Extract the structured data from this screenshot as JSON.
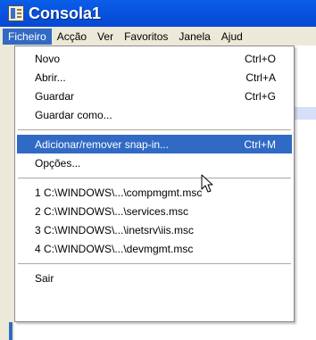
{
  "window": {
    "title": "Consola1",
    "icon": "mmc-console-icon"
  },
  "menubar": {
    "items": [
      {
        "label": "Ficheiro",
        "active": true
      },
      {
        "label": "Acção"
      },
      {
        "label": "Ver"
      },
      {
        "label": "Favoritos"
      },
      {
        "label": "Janela"
      },
      {
        "label": "Ajud"
      }
    ]
  },
  "file_menu": {
    "items": [
      {
        "label": "Novo",
        "shortcut": "Ctrl+O"
      },
      {
        "label": "Abrir...",
        "shortcut": "Ctrl+A"
      },
      {
        "label": "Guardar",
        "shortcut": "Ctrl+G"
      },
      {
        "label": "Guardar  como...",
        "shortcut": ""
      },
      {
        "label": "Adicionar/remover snap-in...",
        "shortcut": "Ctrl+M",
        "highlighted": true
      },
      {
        "label": "Opções...",
        "shortcut": ""
      },
      {
        "label": "1 C:\\WINDOWS\\...\\compmgmt.msc",
        "shortcut": ""
      },
      {
        "label": "2 C:\\WINDOWS\\...\\services.msc",
        "shortcut": ""
      },
      {
        "label": "3 C:\\WINDOWS\\...\\inetsrv\\iis.msc",
        "shortcut": ""
      },
      {
        "label": "4 C:\\WINDOWS\\...\\devmgmt.msc",
        "shortcut": ""
      },
      {
        "label": "Sair",
        "shortcut": ""
      }
    ]
  },
  "colors": {
    "titlebar": "#0753e0",
    "highlight": "#316ac5",
    "menubar_bg": "#ece9d8"
  }
}
